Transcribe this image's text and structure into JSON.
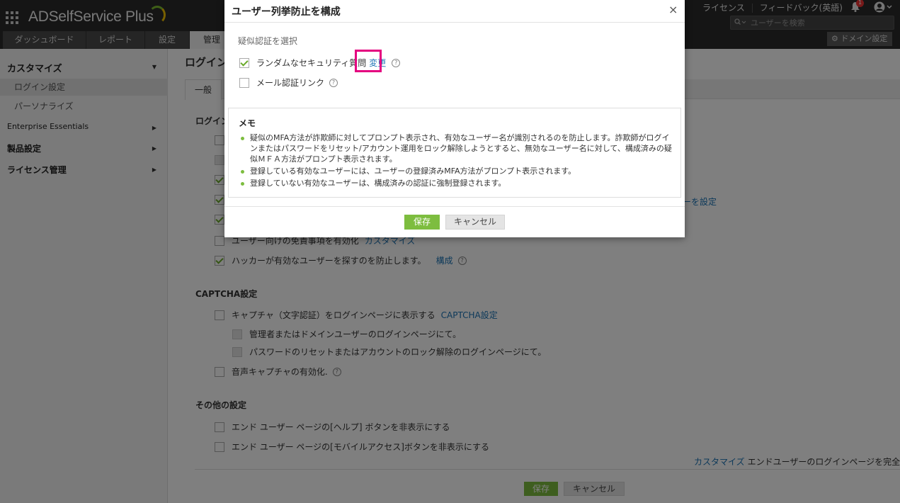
{
  "header": {
    "app_name": "ADSelfService Plus",
    "top_links": [
      "ライセンス",
      "フィードバック(英語)"
    ],
    "notification_count": "1",
    "search_placeholder": "ユーザーを検索",
    "domain_settings": "ドメイン設定"
  },
  "nav": {
    "tabs": [
      "ダッシュボード",
      "レポート",
      "設定",
      "管理"
    ],
    "active_tab": "管理"
  },
  "sidebar": {
    "customize": "カスタマイズ",
    "login_settings": "ログイン設定",
    "personalize": "パーソナライズ",
    "enterprise": "Enterprise Essentials",
    "product_settings": "製品設定",
    "license_mgmt": "ライセンス管理"
  },
  "main": {
    "page_title": "ログイン",
    "tab_general": "一般",
    "section_login": "ログイン",
    "trailing_link": "ーを設定",
    "disclaimer_label": "ユーザー向けの免責事項を有効化",
    "disclaimer_link": "カスタマイズ",
    "hacker_label": "ハッカーが有効なユーザーを探すのを防止します。",
    "hacker_link": "構成",
    "captcha_title": "CAPTCHA設定",
    "captcha_label": "キャプチャ（文字認証）をログインページに表示する",
    "captcha_link": "CAPTCHA設定",
    "captcha_admin": "管理者またはドメインユーザーのログインページにて。",
    "captcha_reset": "パスワードのリセットまたはアカウントのロック解除のログインページにて。",
    "audio_captcha": "音声キャプチャの有効化.",
    "other_title": "その他の設定",
    "hide_help": "エンド ユーザー ページの[ヘルプ] ボタンを非表示にする",
    "hide_mobile": "エンド ユーザー ページの[モバイルアクセス]ボタンを非表示にする",
    "customize_link": "カスタマイズ",
    "customize_text": "エンドユーザーのログインページを完全にHT",
    "save": "保存",
    "cancel": "キャンセル"
  },
  "dialog": {
    "title": "ユーザー列挙防止を構成",
    "close": "×",
    "label": "疑似認証を選択",
    "option1": "ランダムなセキュリティ質問",
    "option1_link": "変更",
    "option2": "メール認証リンク",
    "memo_title": "メモ",
    "memo_items": [
      "疑似のMFA方法が詐欺師に対してプロンプト表示され、有効なユーザー名が識別されるのを防止します。詐欺師がログインまたはパスワードをリセット/アカウント運用をロック解除しようとすると、無効なユーザー名に対して、構成済みの疑似ＭＦＡ方法がプロンプト表示されます。",
      "登録している有効なユーザーには、ユーザーの登録済みMFA方法がプロンプト表示されます。",
      "登録していない有効なユーザーは、構成済みの認証に強制登録されます。"
    ],
    "save": "保存",
    "cancel": "キャンセル"
  },
  "help_glyph": "?"
}
